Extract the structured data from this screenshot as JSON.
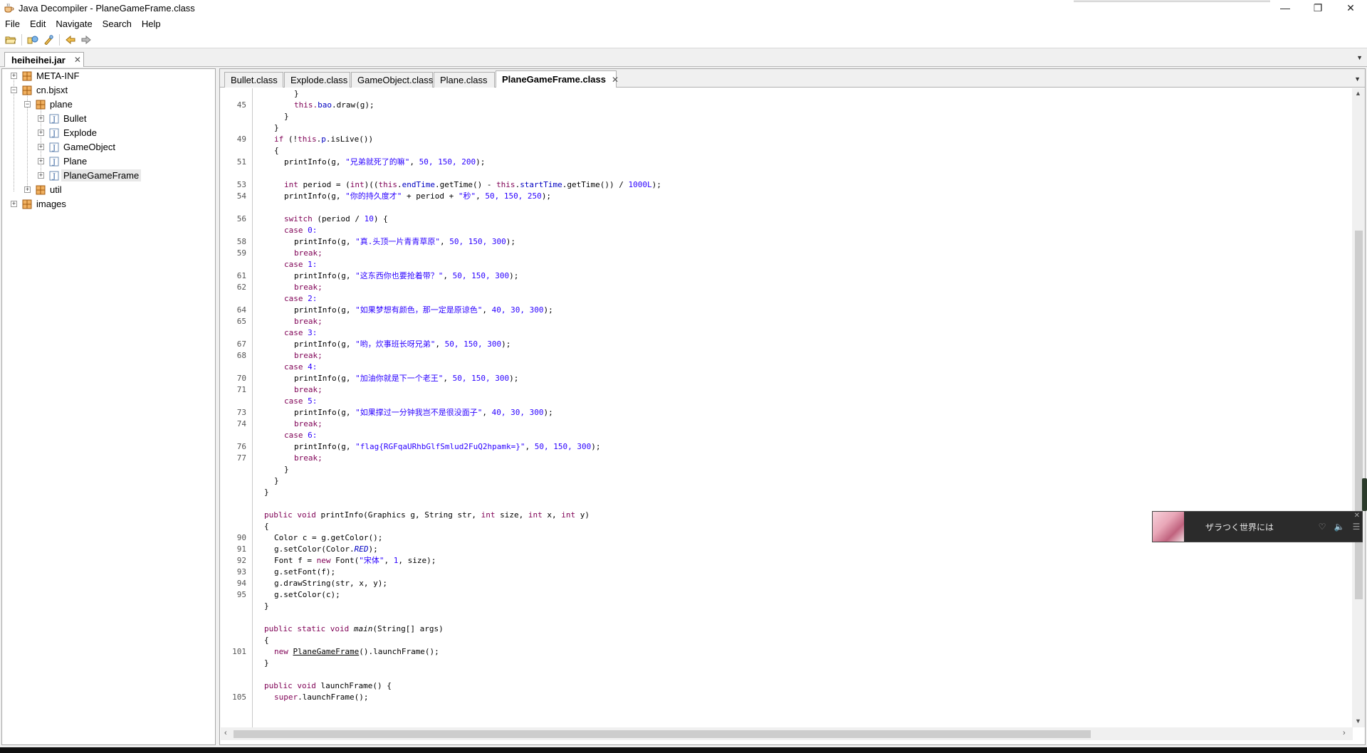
{
  "window": {
    "title": "Java Decompiler - PlaneGameFrame.class",
    "controls": {
      "minimize": "—",
      "restore": "❐",
      "close": "✕"
    }
  },
  "menu": [
    "File",
    "Edit",
    "Navigate",
    "Search",
    "Help"
  ],
  "toolbar": {
    "buttons": [
      "open-file-icon",
      "open-type-icon",
      "search-icon",
      "back-icon",
      "forward-icon"
    ]
  },
  "jar_tab": {
    "label": "heiheihei.jar",
    "close": "✕"
  },
  "tree": {
    "items": [
      {
        "label": "META-INF"
      },
      {
        "label": "cn.bjsxt"
      },
      {
        "label": "plane"
      },
      {
        "label": "Bullet"
      },
      {
        "label": "Explode"
      },
      {
        "label": "GameObject"
      },
      {
        "label": "Plane"
      },
      {
        "label": "PlaneGameFrame"
      },
      {
        "label": "util"
      },
      {
        "label": "images"
      }
    ]
  },
  "class_tabs": [
    {
      "label": "Bullet.class"
    },
    {
      "label": "Explode.class"
    },
    {
      "label": "GameObject.class"
    },
    {
      "label": "Plane.class"
    },
    {
      "label": "PlaneGameFrame.class"
    }
  ],
  "active_tab_close": "✕",
  "line_numbers": [
    "45",
    "49",
    "51",
    "53",
    "54",
    "56",
    "58",
    "59",
    "61",
    "62",
    "64",
    "65",
    "67",
    "68",
    "70",
    "71",
    "73",
    "74",
    "76",
    "77",
    "90",
    "91",
    "92",
    "93",
    "94",
    "95",
    "101",
    "105"
  ],
  "code": {
    "s_bao_brace": "}",
    "s_bao_draw_a": "this.",
    "s_bao_draw_b": "bao",
    "s_bao_draw_c": ".draw(g);",
    "s_brace1": "}",
    "s_brace2": "}",
    "if_kw": "if",
    "if_rest_a": " (!",
    "if_this": "this",
    "if_rest_b": ".",
    "if_p": "p",
    "if_rest_c": ".isLive())",
    "open1": "{",
    "pi51_a": "printInfo(g, ",
    "pi51_s": "\"兄弟就死了的嘛\"",
    "pi51_b": ", ",
    "pi51_n": "50, 150, 200",
    "pi51_c": ");",
    "p53_kw": "int",
    "p53_a": " period = (",
    "p53_kw2": "int",
    "p53_b": ")((",
    "p53_this1": "this",
    "p53_c": ".",
    "p53_f1": "endTime",
    "p53_d": ".getTime() - ",
    "p53_this2": "this",
    "p53_e": ".",
    "p53_f2": "startTime",
    "p53_g": ".getTime()) / ",
    "p53_n": "1000L",
    "p53_h": ");",
    "pi54_a": "printInfo(g, ",
    "pi54_s1": "\"你的持久度才\"",
    "pi54_b": " + period + ",
    "pi54_s2": "\"秒\"",
    "pi54_c": ", ",
    "pi54_n": "50, 150, 250",
    "pi54_d": ");",
    "sw_kw": "switch",
    "sw_a": " (period / ",
    "sw_n": "10",
    "sw_b": ") {",
    "case_kw": "case",
    "c0": " 0:",
    "c1": " 1:",
    "c2": " 2:",
    "c3": " 3:",
    "c4": " 4:",
    "c5": " 5:",
    "c6": " 6:",
    "brk": "break;",
    "pi_pre": "printInfo(g, ",
    "pi_sep": ", ",
    "pi_end": ");",
    "s58": "\"真.头顶一片青青草原\"",
    "n58": "50, 150, 300",
    "s61": "\"这东西你也要抢着带？\"",
    "n61": "50, 150, 300",
    "s64": "\"如果梦想有颜色，那一定是原谅色\"",
    "n64": "40, 30, 300",
    "s67": "\"哟，炊事班长呀兄弟\"",
    "n67": "50, 150, 300",
    "s70": "\"加油你就是下一个老王\"",
    "n70": "50, 150, 300",
    "s73": "\"如果撑过一分钟我岂不是很没面子\"",
    "n73": "40, 30, 300",
    "s76": "\"flag{RGFqaURhbGlfSmlud2FuQ2hpamk=}\"",
    "n76": "50, 150, 300",
    "cb1": "}",
    "cb2": "}",
    "cb3": "}",
    "pv_kw1": "public",
    "pv_kw2": "void",
    "pv_a": " printInfo(Graphics g, String str, ",
    "pv_int1": "int",
    "pv_b": " size, ",
    "pv_int2": "int",
    "pv_c": " x, ",
    "pv_int3": "int",
    "pv_d": " y)",
    "open2": "{",
    "l90": "Color c = g.getColor();",
    "l91_a": "g.setColor(Color.",
    "l91_f": "RED",
    "l91_b": ");",
    "l92_a": "Font f = ",
    "l92_kw": "new",
    "l92_b": " Font(",
    "l92_s": "\"宋体\"",
    "l92_c": ", ",
    "l92_n": "1",
    "l92_d": ", size);",
    "l93": "g.setFont(f);",
    "l94": "g.drawString(str, x, y);",
    "l95": "g.setColor(c);",
    "cb4": "}",
    "main_kw1": "public",
    "main_kw2": "static",
    "main_kw3": "void",
    "main_name": "main",
    "main_rest": "(String[] args)",
    "open3": "{",
    "l101_kw": "new",
    "l101_cls": "PlaneGameFrame",
    "l101_rest": "().launchFrame();",
    "cb5": "}",
    "lf_kw1": "public",
    "lf_kw2": "void",
    "lf_rest": " launchFrame() {",
    "l105_kw": "super",
    "l105_rest": ".launchFrame();"
  },
  "music_widget": {
    "title": "ザラつく世界には",
    "close": "✕",
    "icons": [
      "heart-icon",
      "volume-icon",
      "playlist-icon"
    ]
  }
}
